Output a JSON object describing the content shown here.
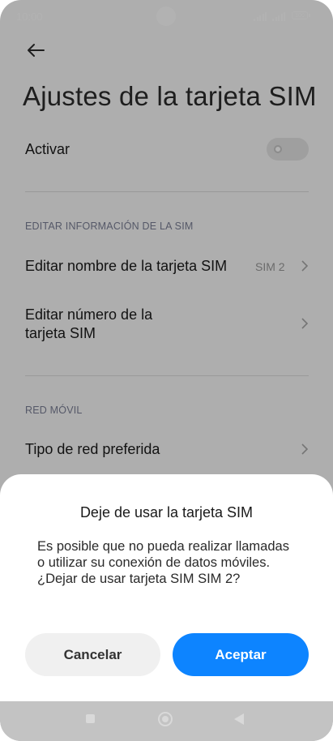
{
  "status_bar": {
    "time": "10:00",
    "battery": "100"
  },
  "header": {
    "title": "Ajustes de la tarjeta SIM"
  },
  "activate": {
    "label": "Activar",
    "enabled": false
  },
  "section_sim_info": {
    "title": "EDITAR INFORMACIÓN DE LA SIM",
    "items": [
      {
        "label": "Editar nombre de la tarjeta SIM",
        "value": "SIM 2"
      },
      {
        "label_line1": "Editar número de la",
        "label_line2": "tarjeta SIM"
      }
    ]
  },
  "section_network": {
    "title": "RED MÓVIL",
    "items": [
      {
        "label": "Tipo de red preferida"
      }
    ]
  },
  "dialog": {
    "title": "Deje de usar la tarjeta SIM",
    "message": "Es posible que no pueda realizar llamadas o utilizar su conexión de datos móviles. ¿Dejar de usar tarjeta SIM SIM 2?",
    "cancel_label": "Cancelar",
    "accept_label": "Aceptar"
  },
  "colors": {
    "accent": "#0d84ff",
    "overlay": "rgba(0,0,0,0.30)"
  },
  "icons": [
    "back-arrow-icon",
    "chevron-right-icon",
    "signal-icon",
    "battery-icon",
    "recents-icon",
    "home-icon",
    "nav-back-icon"
  ]
}
